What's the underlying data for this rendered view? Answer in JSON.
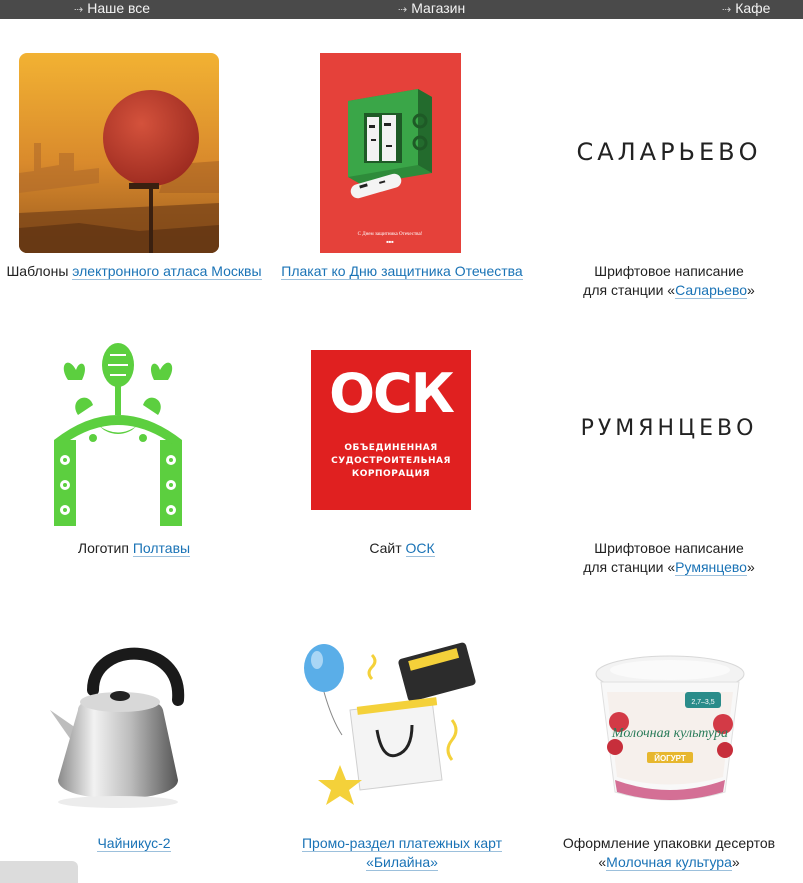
{
  "nav": {
    "items": [
      "Наше все",
      "Магазин",
      "Кафе"
    ]
  },
  "works": {
    "atlas": {
      "prefix": "Шаблоны ",
      "link": "электронного атласа Москвы"
    },
    "poster": {
      "link": "Плакат ко Дню защитника Отечества",
      "caption_text": "С Днем защитника Отечества!"
    },
    "salaryevo": {
      "line1": "Шрифтовое написание",
      "line2_prefix": "для станции «",
      "link": "Саларьево",
      "line2_suffix": "»",
      "wordmark": "САЛАРЬЕВО"
    },
    "poltava": {
      "prefix": "Логотип ",
      "link": "Полтавы"
    },
    "osk": {
      "prefix": "Сайт ",
      "link": "ОСК",
      "logo_big": "ОСК",
      "logo_lines": [
        "ОБЪЕДИНЕННАЯ",
        "СУДОСТРОИТЕЛЬНАЯ",
        "КОРПОРАЦИЯ"
      ]
    },
    "rumyantsevo": {
      "line1": "Шрифтовое написание",
      "line2_prefix": "для станции «",
      "link": "Румянцево",
      "line2_suffix": "»",
      "wordmark": "РУМЯНЦЕВО"
    },
    "kettle": {
      "link": "Чайникус-2"
    },
    "beeline": {
      "link_line1": "Промо-раздел платежных карт",
      "link_line2": "«Билайна»"
    },
    "dessert": {
      "line1": "Оформление упаковки десертов",
      "line2_prefix": "«",
      "link": "Молочная культура",
      "line2_suffix": "»",
      "pack_brand": "Молочная культура",
      "pack_product": "ЙОГУРТ",
      "pack_fat": "2,7–3,5"
    }
  },
  "colors": {
    "link": "#1a73b6",
    "nav_bg": "#4a4a4a",
    "osk_red": "#e02020",
    "poster_red": "#e5413a",
    "poltava_green": "#5ccf3f"
  }
}
